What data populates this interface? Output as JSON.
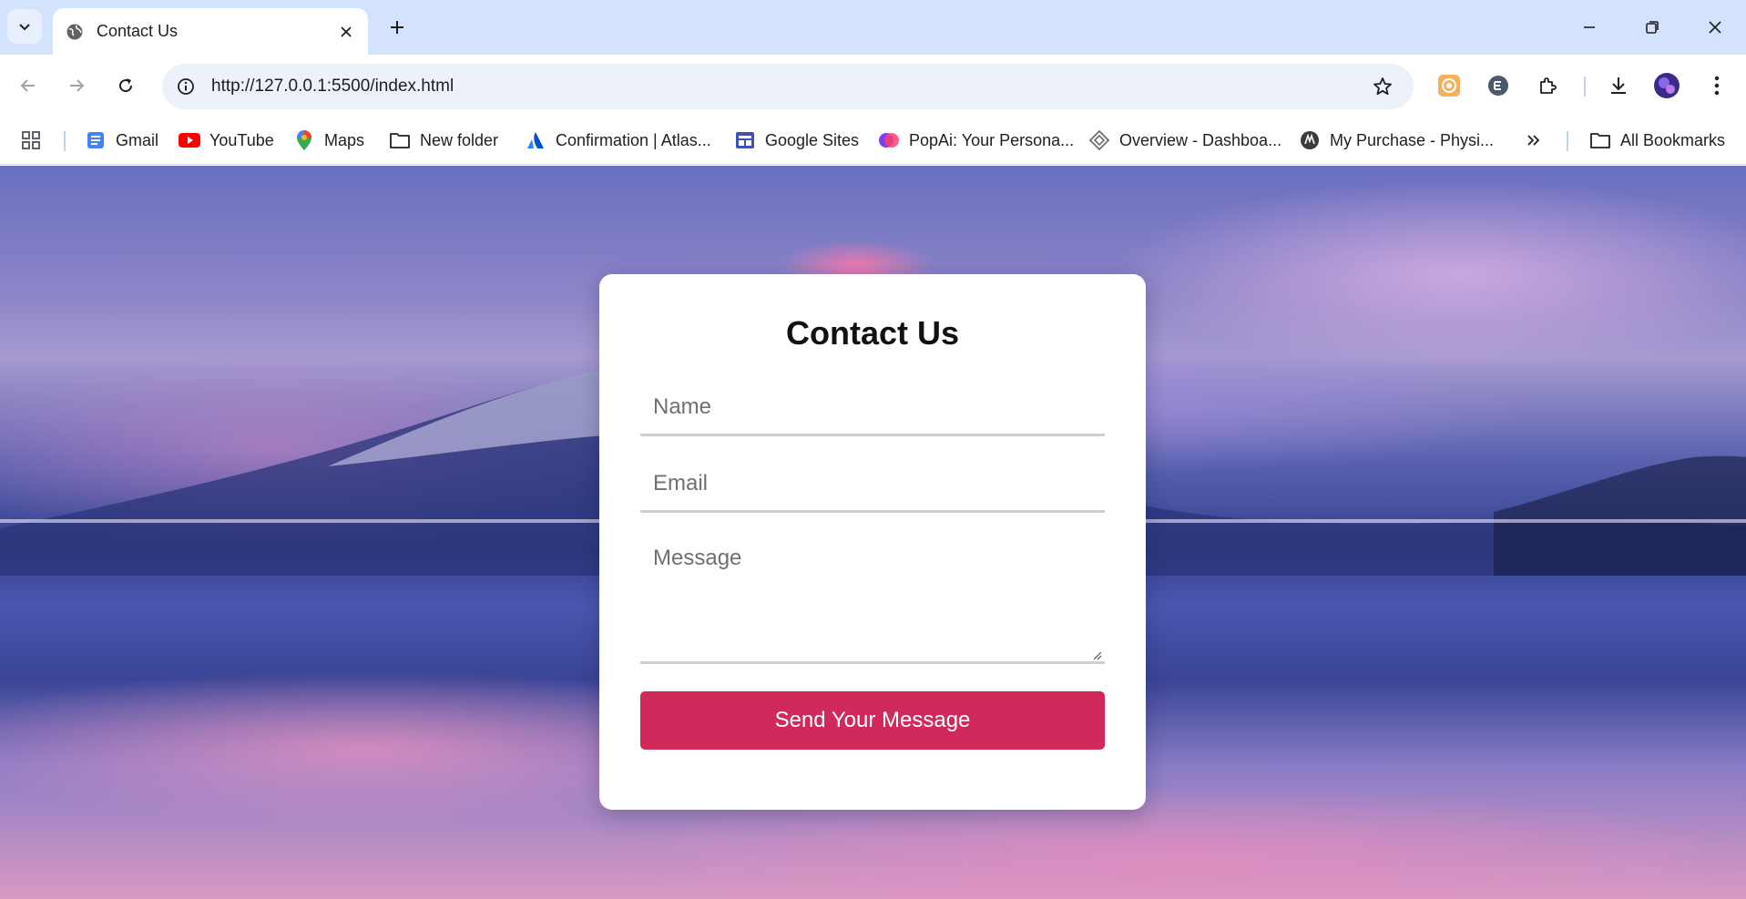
{
  "browser": {
    "tab": {
      "title": "Contact Us"
    },
    "address_bar": {
      "url": "http://127.0.0.1:5500/index.html"
    },
    "bookmarks": [
      {
        "label": "Gmail",
        "icon": "gmail-icon"
      },
      {
        "label": "YouTube",
        "icon": "youtube-icon"
      },
      {
        "label": "Maps",
        "icon": "maps-icon"
      },
      {
        "label": "New folder",
        "icon": "folder-icon"
      },
      {
        "label": "Confirmation | Atlas...",
        "icon": "atlassian-icon"
      },
      {
        "label": "Google Sites",
        "icon": "google-sites-icon"
      },
      {
        "label": "PopAi: Your Persona...",
        "icon": "popai-icon"
      },
      {
        "label": "Overview - Dashboa...",
        "icon": "dashboard-icon"
      },
      {
        "label": "My Purchase - Physi...",
        "icon": "physics-icon"
      }
    ],
    "all_bookmarks_label": "All Bookmarks",
    "colors": {
      "tabstrip": "#d3e3fd",
      "omnibox": "#edf2fa"
    }
  },
  "contact_form": {
    "title": "Contact Us",
    "name_placeholder": "Name",
    "email_placeholder": "Email",
    "message_placeholder": "Message",
    "submit_label": "Send Your Message",
    "colors": {
      "button": "#cf2a5b",
      "card": "#ffffff"
    }
  }
}
